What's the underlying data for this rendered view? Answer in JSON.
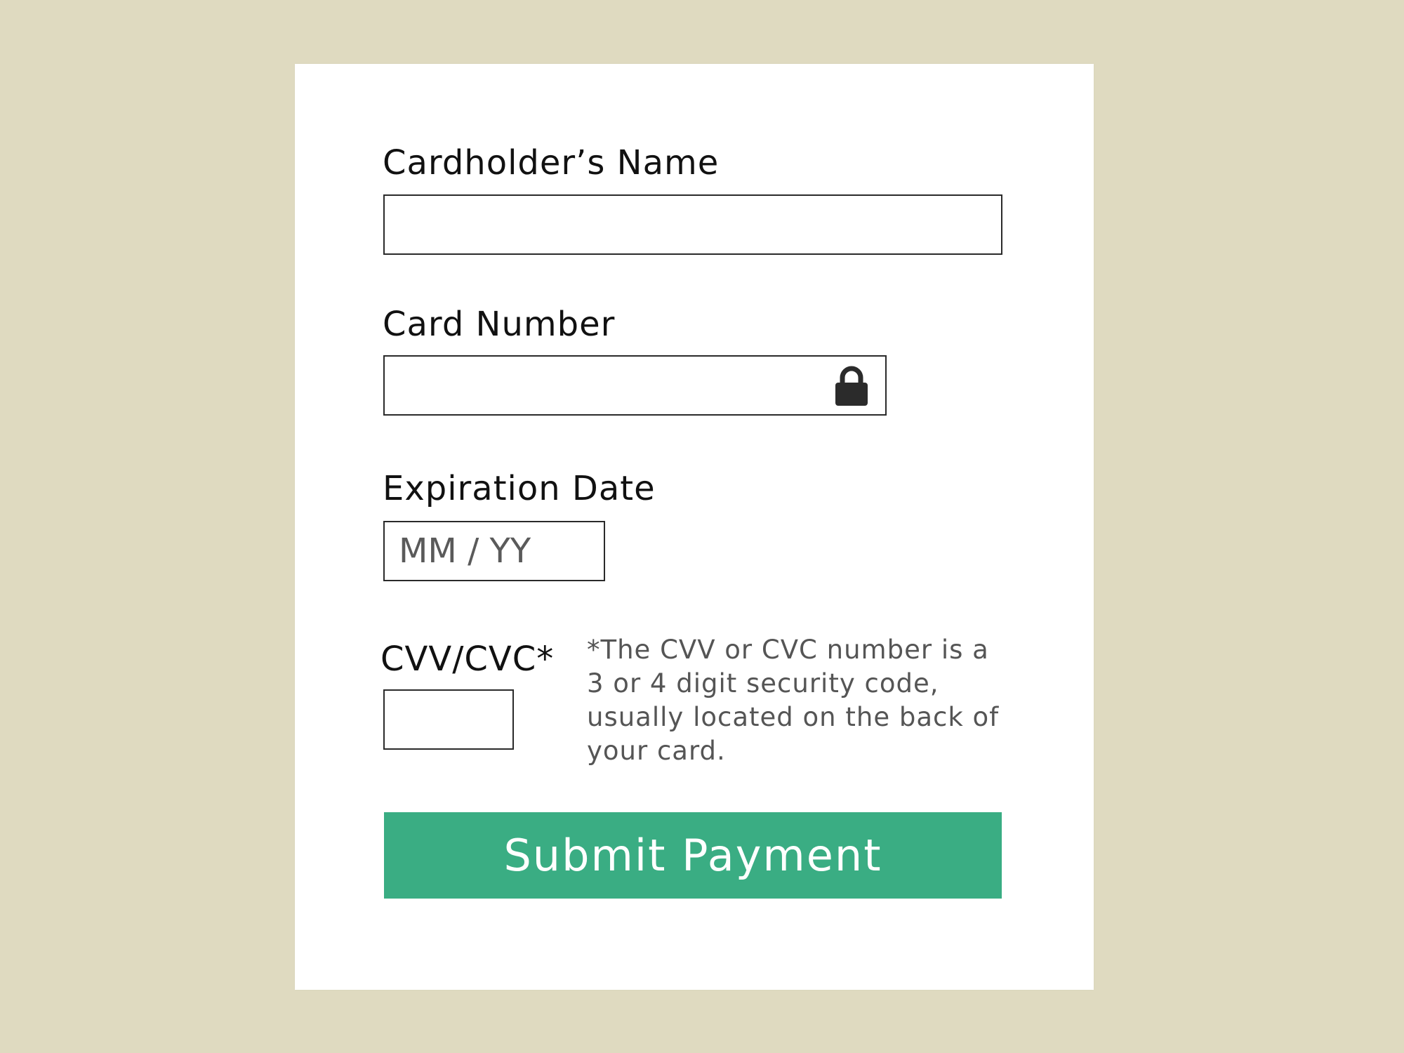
{
  "form": {
    "name_label": "Cardholder’s Name",
    "name_value": "",
    "card_number_label": "Card Number",
    "card_number_value": "",
    "card_number_icon": "lock-icon",
    "expiration_label": "Expiration Date",
    "expiration_placeholder": "MM / YY",
    "expiration_value": "",
    "cvv_label": "CVV/CVC*",
    "cvv_value": "",
    "cvv_note": "*The CVV or CVC number is a 3 or 4 digit security code, usually located on the back of your card.",
    "submit_label": "Submit Payment"
  },
  "colors": {
    "background": "#dfdac0",
    "card": "#ffffff",
    "accent": "#3aad83",
    "border": "#2a2a2a",
    "note_text": "#555555"
  }
}
